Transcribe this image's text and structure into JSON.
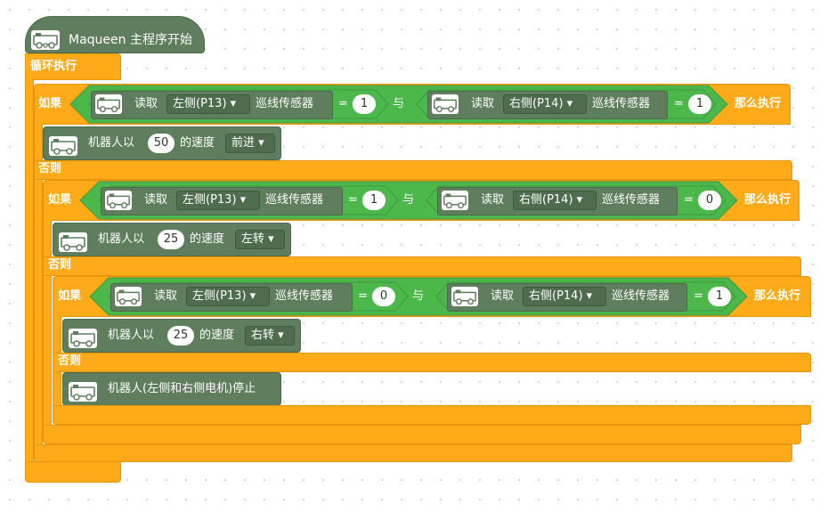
{
  "program": {
    "hat_label": "Maqueen 主程序开始",
    "loop_label": "循环执行"
  },
  "labels": {
    "if": "如果",
    "then": "那么执行",
    "else": "否则",
    "and": "与",
    "read": "读取",
    "sensor": "巡线传感器",
    "eq": "=",
    "speed_prefix": "机器人以",
    "speed_suffix": "的速度"
  },
  "if1": {
    "left_port": "左侧(P13)",
    "left_value": "1",
    "right_port": "右侧(P14)",
    "right_value": "1",
    "move_speed": "50",
    "move_dir": "前进"
  },
  "if2": {
    "left_port": "左侧(P13)",
    "left_value": "1",
    "right_port": "右侧(P14)",
    "right_value": "0",
    "move_speed": "25",
    "move_dir": "左转"
  },
  "if3": {
    "left_port": "左侧(P13)",
    "left_value": "0",
    "right_port": "右侧(P14)",
    "right_value": "1",
    "move_speed": "25",
    "move_dir": "右转",
    "stop_label": "机器人(左侧和右侧电机)停止"
  }
}
